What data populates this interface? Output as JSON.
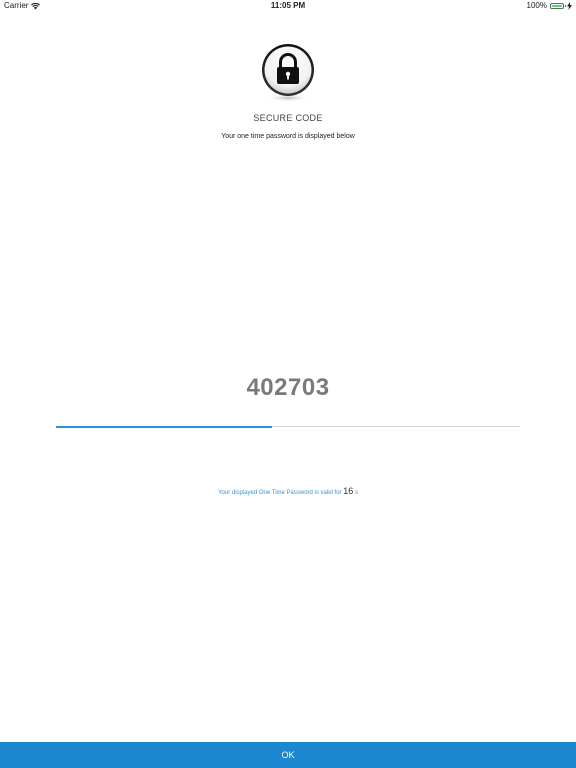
{
  "status_bar": {
    "carrier": "Carrier",
    "time": "11:05 PM",
    "battery_percent": "100%",
    "icons": [
      "wifi-icon",
      "battery-icon",
      "charging-icon"
    ]
  },
  "header": {
    "icon": "padlock-icon",
    "title": "SECURE CODE",
    "subtitle": "Your one time password is displayed below"
  },
  "otp": {
    "code": "402703",
    "progress_fraction": 0.465
  },
  "validity": {
    "prefix": "Your displayed One Time Password is valid for",
    "seconds": "16",
    "unit": "s"
  },
  "footer": {
    "ok_label": "OK"
  },
  "colors": {
    "accent": "#1b87d1",
    "progress": "#2a8fd6",
    "otp_text": "#7a7a7a",
    "validity_text": "#3c92cf"
  }
}
